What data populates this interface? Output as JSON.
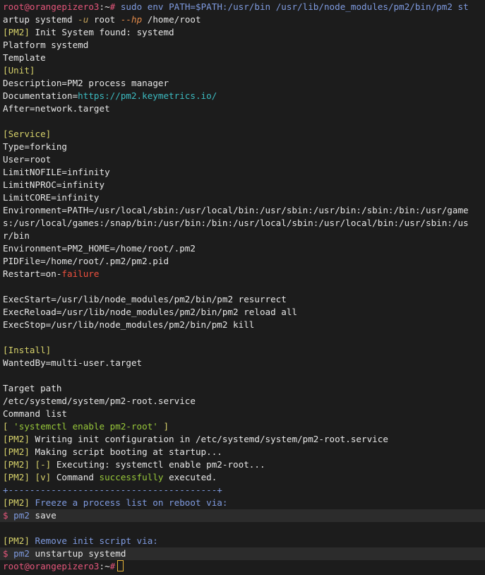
{
  "prompt": {
    "user_host": "root@orangepizero3",
    "path": ":~",
    "symbol": "#"
  },
  "command": {
    "line1_pre": " sudo env ",
    "env_assign": "PATH=$PATH:/usr/bin /usr/lib/node_modules/pm2/bin/pm2 st",
    "line2_pre": "artup systemd ",
    "flag_u": "-u",
    "user": " root ",
    "flag_hp": "--hp",
    "home": " /home/root"
  },
  "init_found": {
    "tag": "[PM2]",
    "text": " Init System found: systemd"
  },
  "platform": "Platform systemd",
  "template": "Template",
  "unit": {
    "header": "[Unit]",
    "description_key": "Description=",
    "description_val": "PM2 process manager",
    "documentation_key": "Documentation=",
    "documentation_url": "https://pm2.keymetrics.io/",
    "after_key": "After=",
    "after_val": "network.target"
  },
  "service": {
    "header": "[Service]",
    "type_key": "Type=",
    "type_val": "forking",
    "user_key": "User=",
    "user_val": "root",
    "nofile_key": "LimitNOFILE=",
    "nofile_val": "infinity",
    "nproc_key": "LimitNPROC=",
    "nproc_val": "infinity",
    "core_key": "LimitCORE=",
    "core_val": "infinity",
    "env_path_line1": "Environment=PATH=/usr/local/sbin:/usr/local/bin:/usr/sbin:/usr/bin:/sbin:/bin:/usr/game",
    "env_path_line2": "s:/usr/local/games:/snap/bin:/usr/bin:/bin:/usr/local/sbin:/usr/local/bin:/usr/sbin:/us",
    "env_path_line3": "r/bin",
    "env_home": "Environment=PM2_HOME=/home/root/.pm2",
    "pidfile": "PIDFile=/home/root/.pm2/pm2.pid",
    "restart_key": "Restart=on-",
    "restart_val": "failure",
    "exec_start": "ExecStart=/usr/lib/node_modules/pm2/bin/pm2 resurrect",
    "exec_reload": "ExecReload=/usr/lib/node_modules/pm2/bin/pm2 reload all",
    "exec_stop": "ExecStop=/usr/lib/node_modules/pm2/bin/pm2 kill"
  },
  "install": {
    "header": "[Install]",
    "wanted_by": "WantedBy=multi-user.target"
  },
  "target": {
    "label": "Target path",
    "path": "/etc/systemd/system/pm2-root.service",
    "command_list_label": "Command list",
    "list_open": "[ ",
    "list_item": "'systemctl enable pm2-root'",
    "list_close": " ]"
  },
  "pm2_log": [
    {
      "tag": "[PM2]",
      "text": " Writing init configuration in /etc/systemd/system/pm2-root.service"
    },
    {
      "tag": "[PM2]",
      "text": " Making script booting at startup..."
    }
  ],
  "executing": {
    "tag": "[PM2]",
    "mark": " [-]",
    "text": " Executing: systemctl enable pm2-root..."
  },
  "success": {
    "tag": "[PM2]",
    "mark": " [v]",
    "pre": " Command ",
    "word": "successfully",
    "post": " executed."
  },
  "separator": "+---------------------------------------+",
  "freeze": {
    "tag": "[PM2]",
    "text": " Freeze a process list on reboot via:",
    "dollar": "$",
    "cmd": " pm2",
    "arg": " save"
  },
  "remove": {
    "tag": "[PM2]",
    "text": " Remove init script via:",
    "dollar": "$",
    "cmd": " pm2",
    "arg": " unstartup systemd"
  },
  "colors": {
    "background": "#1c1c1c",
    "highlight_row": "#2c2c2c",
    "prompt": "#e5567b",
    "tag": "#d6d16a",
    "key_value": "#98c83a",
    "url": "#3cbbc1",
    "failure": "#f0503e",
    "hint_text": "#7f9be0",
    "cursor": "#e5b238"
  }
}
